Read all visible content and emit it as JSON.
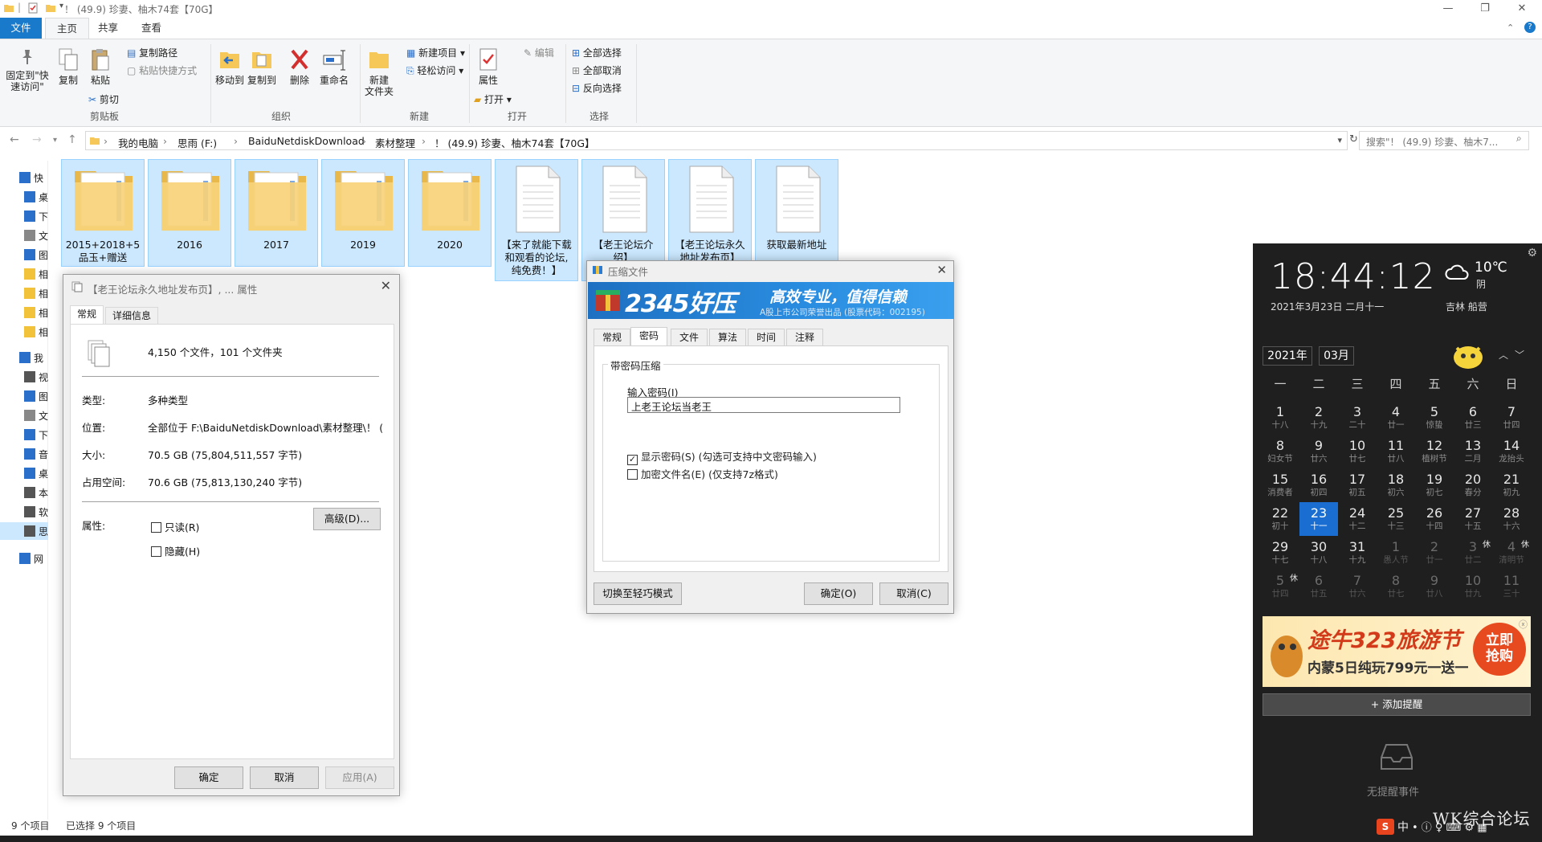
{
  "window": {
    "title": "！  (49.9) 珍妻、柚木74套【70G】",
    "ribbon_tabs": [
      "文件",
      "主页",
      "共享",
      "查看"
    ]
  },
  "ribbon": {
    "clipboard": {
      "pin": "固定到\"快\n速访问\"",
      "copy": "复制",
      "paste": "粘贴",
      "copy_path": "复制路径",
      "paste_shortcut": "粘贴快捷方式",
      "cut": "剪切",
      "label": "剪贴板"
    },
    "organize": {
      "move_to": "移动到",
      "copy_to": "复制到",
      "delete": "删除",
      "rename": "重命名",
      "label": "组织"
    },
    "new": {
      "new_folder": "新建\n文件夹",
      "new_item": "新建项目",
      "easy_access": "轻松访问",
      "label": "新建"
    },
    "open": {
      "properties": "属性",
      "open": "打开",
      "edit": "编辑",
      "label": "打开"
    },
    "select": {
      "select_all": "全部选择",
      "select_none": "全部取消",
      "invert": "反向选择",
      "label": "选择"
    }
  },
  "address": {
    "crumbs": [
      "我的电脑",
      "思雨 (F:)",
      "BaiduNetdiskDownload",
      "素材整理",
      "！  (49.9) 珍妻、柚木74套【70G】"
    ],
    "search_placeholder": "搜索\"！  (49.9) 珍妻、柚木7..."
  },
  "sidebar": {
    "items": [
      "快",
      "桌",
      "下",
      "文",
      "图",
      "相",
      "相",
      "相",
      "相",
      "我",
      "视",
      "图",
      "文",
      "下",
      "音",
      "桌",
      "本",
      "软",
      "思",
      "网"
    ]
  },
  "files": [
    {
      "name": "2015+2018+5\n品玉+赠送",
      "type": "folder"
    },
    {
      "name": "2016",
      "type": "folder"
    },
    {
      "name": "2017",
      "type": "folder"
    },
    {
      "name": "2019",
      "type": "folder"
    },
    {
      "name": "2020",
      "type": "folder"
    },
    {
      "name": "【来了就能下载\n和观看的论坛,\n纯免费！】",
      "type": "doc"
    },
    {
      "name": "【老王论坛介\n绍】",
      "type": "doc"
    },
    {
      "name": "【老王论坛永久\n地址发布页】",
      "type": "doc"
    },
    {
      "name": "获取最新地址",
      "type": "doc"
    }
  ],
  "status": {
    "count": "9 个项目",
    "selected": "已选择 9 个项目"
  },
  "properties_dialog": {
    "title": "【老王论坛永久地址发布页】, ... 属性",
    "tabs": [
      "常规",
      "详细信息"
    ],
    "summary": "4,150 个文件，101 个文件夹",
    "type_label": "类型:",
    "type_value": "多种类型",
    "location_label": "位置:",
    "location_value": "全部位于 F:\\BaiduNetdiskDownload\\素材整理\\！  (",
    "size_label": "大小:",
    "size_value": "70.5 GB (75,804,511,557 字节)",
    "disk_label": "占用空间:",
    "disk_value": "70.6 GB (75,813,130,240 字节)",
    "attr_label": "属性:",
    "readonly": "只读(R)",
    "hidden": "隐藏(H)",
    "advanced": "高级(D)...",
    "ok": "确定",
    "cancel": "取消",
    "apply": "应用(A)"
  },
  "zip_dialog": {
    "title": "压缩文件",
    "brand": "2345好压",
    "slogan": "高效专业，值得信赖",
    "subslogan": "A股上市公司荣誉出品 (股票代码：002195)",
    "tabs": [
      "常规",
      "密码",
      "文件",
      "算法",
      "时间",
      "注释"
    ],
    "group_title": "带密码压缩",
    "pw_label": "输入密码(I)",
    "pw_value": "上老王论坛当老王",
    "show_pw": "显示密码(S) (勾选可支持中文密码输入)",
    "encrypt_names": "加密文件名(E) (仅支持7z格式)",
    "switch_mode": "切换至轻巧模式",
    "ok": "确定(O)",
    "cancel": "取消(C)"
  },
  "calendar": {
    "time": "18:44:12",
    "date": "2021年3月23日 二月十一",
    "temp": "10℃",
    "weather": "阴",
    "location": "吉林 船营",
    "year": "2021年",
    "month": "03月",
    "weekdays": [
      "一",
      "二",
      "三",
      "四",
      "五",
      "六",
      "日"
    ],
    "days": [
      {
        "n": "1",
        "l": "十八"
      },
      {
        "n": "2",
        "l": "十九"
      },
      {
        "n": "3",
        "l": "二十"
      },
      {
        "n": "4",
        "l": "廿一"
      },
      {
        "n": "5",
        "l": "惊蛰"
      },
      {
        "n": "6",
        "l": "廿三"
      },
      {
        "n": "7",
        "l": "廿四"
      },
      {
        "n": "8",
        "l": "妇女节"
      },
      {
        "n": "9",
        "l": "廿六"
      },
      {
        "n": "10",
        "l": "廿七"
      },
      {
        "n": "11",
        "l": "廿八"
      },
      {
        "n": "12",
        "l": "植树节"
      },
      {
        "n": "13",
        "l": "二月"
      },
      {
        "n": "14",
        "l": "龙抬头"
      },
      {
        "n": "15",
        "l": "消费者"
      },
      {
        "n": "16",
        "l": "初四"
      },
      {
        "n": "17",
        "l": "初五"
      },
      {
        "n": "18",
        "l": "初六"
      },
      {
        "n": "19",
        "l": "初七"
      },
      {
        "n": "20",
        "l": "春分"
      },
      {
        "n": "21",
        "l": "初九"
      },
      {
        "n": "22",
        "l": "初十"
      },
      {
        "n": "23",
        "l": "十一",
        "today": true
      },
      {
        "n": "24",
        "l": "十二"
      },
      {
        "n": "25",
        "l": "十三"
      },
      {
        "n": "26",
        "l": "十四"
      },
      {
        "n": "27",
        "l": "十五"
      },
      {
        "n": "28",
        "l": "十六"
      },
      {
        "n": "29",
        "l": "十七"
      },
      {
        "n": "30",
        "l": "十八"
      },
      {
        "n": "31",
        "l": "十九"
      },
      {
        "n": "1",
        "l": "愚人节",
        "dim": true
      },
      {
        "n": "2",
        "l": "廿一",
        "dim": true
      },
      {
        "n": "3",
        "l": "廿二",
        "dim": true,
        "rest": "休"
      },
      {
        "n": "4",
        "l": "清明节",
        "dim": true,
        "rest": "休"
      },
      {
        "n": "5",
        "l": "廿四",
        "dim": true,
        "rest": "休"
      },
      {
        "n": "6",
        "l": "廿五",
        "dim": true
      },
      {
        "n": "7",
        "l": "廿六",
        "dim": true
      },
      {
        "n": "8",
        "l": "廿七",
        "dim": true
      },
      {
        "n": "9",
        "l": "廿八",
        "dim": true
      },
      {
        "n": "10",
        "l": "廿九",
        "dim": true
      },
      {
        "n": "11",
        "l": "三十",
        "dim": true
      }
    ],
    "ad_title": "途牛323旅游节",
    "ad_sub": "内蒙5日纯玩799元一送一",
    "ad_cta": "立即\n抢购",
    "add_reminder": "+ 添加提醒",
    "no_events": "无提醒事件"
  },
  "tray": {
    "ime": "中",
    "watermark": "WK综合论坛"
  }
}
